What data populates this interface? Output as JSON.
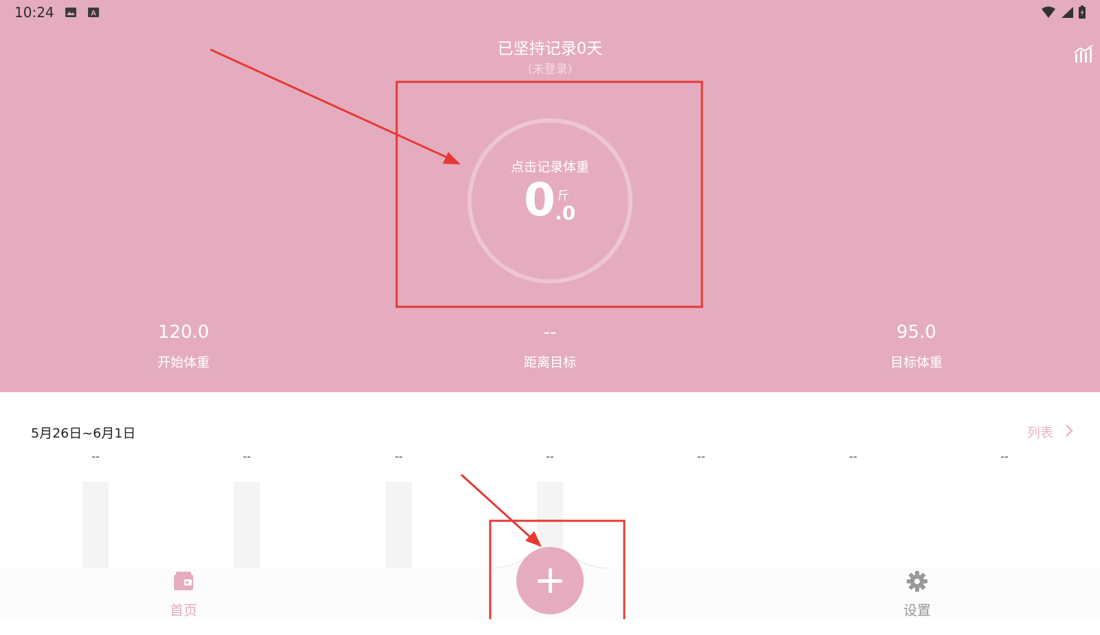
{
  "status_bar": {
    "time": "10:24",
    "icons": [
      "image-icon",
      "a-badge-icon",
      "wifi-icon",
      "signal-icon",
      "battery-icon"
    ]
  },
  "header": {
    "title": "已坚持记录0天",
    "subtitle": "(未登录)",
    "chart_icon": "chart-icon"
  },
  "weight_circle": {
    "prompt": "点击记录体重",
    "integer": "0",
    "unit": "斤",
    "decimal": ".0"
  },
  "stats": [
    {
      "value": "120.0",
      "label": "开始体重"
    },
    {
      "value": "--",
      "label": "距离目标"
    },
    {
      "value": "95.0",
      "label": "目标体重"
    }
  ],
  "week_card": {
    "range": "5月26日~6月1日",
    "list_label": "列表",
    "days": [
      "--",
      "--",
      "--",
      "--",
      "--",
      "--",
      "--"
    ]
  },
  "bottom_nav": {
    "home_label": "首页",
    "settings_label": "设置"
  },
  "colors": {
    "brand": "#e5acbf",
    "annotation": "#e53935"
  }
}
